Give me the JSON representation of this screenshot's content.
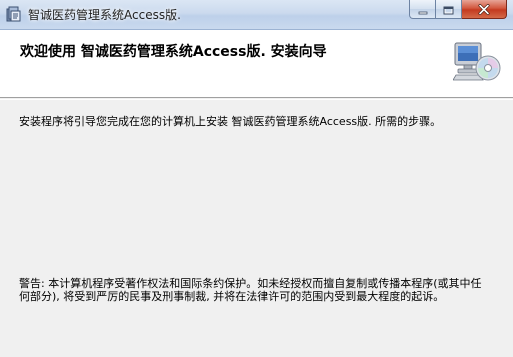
{
  "window": {
    "title": "智诚医药管理系统Access版.",
    "app_icon": "installer-icon",
    "buttons": {
      "minimize_icon": "minimize-icon",
      "maximize_icon": "maximize-icon",
      "close_icon": "close-icon"
    }
  },
  "header": {
    "title": "欢迎使用 智诚医药管理系统Access版. 安装向导",
    "icon": "computer-cd-icon"
  },
  "content": {
    "intro": "安装程序将引导您完成在您的计算机上安装 智诚医药管理系统Access版. 所需的步骤。",
    "warning": "警告: 本计算机程序受著作权法和国际条约保护。如未经授权而擅自复制或传播本程序(或其中任何部分), 将受到严厉的民事及刑事制裁, 并将在法律许可的范围内受到最大程度的起诉。"
  },
  "colors": {
    "close_button": "#c43a20",
    "titlebar": "#cbdaee",
    "dialog_background": "#f0f0f0",
    "header_background": "#ffffff"
  }
}
